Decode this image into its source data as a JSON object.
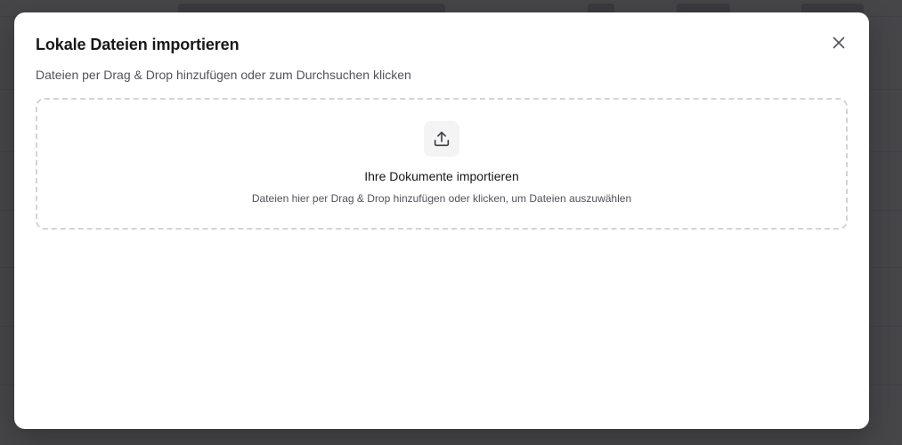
{
  "dialog": {
    "title": "Lokale Dateien importieren",
    "subtitle": "Dateien per Drag & Drop hinzufügen oder zum Durchsuchen klicken",
    "close_icon": "close-icon"
  },
  "dropzone": {
    "icon": "upload-icon",
    "title": "Ihre Dokumente importieren",
    "hint": "Dateien hier per Drag & Drop hinzufügen oder klicken, um Dateien auszuwählen"
  },
  "colors": {
    "overlay": "#18181b",
    "border_dashed": "#d4d4d8",
    "title_text": "#18181b",
    "muted_text": "#52525b",
    "icon_bg": "#f4f4f5"
  }
}
